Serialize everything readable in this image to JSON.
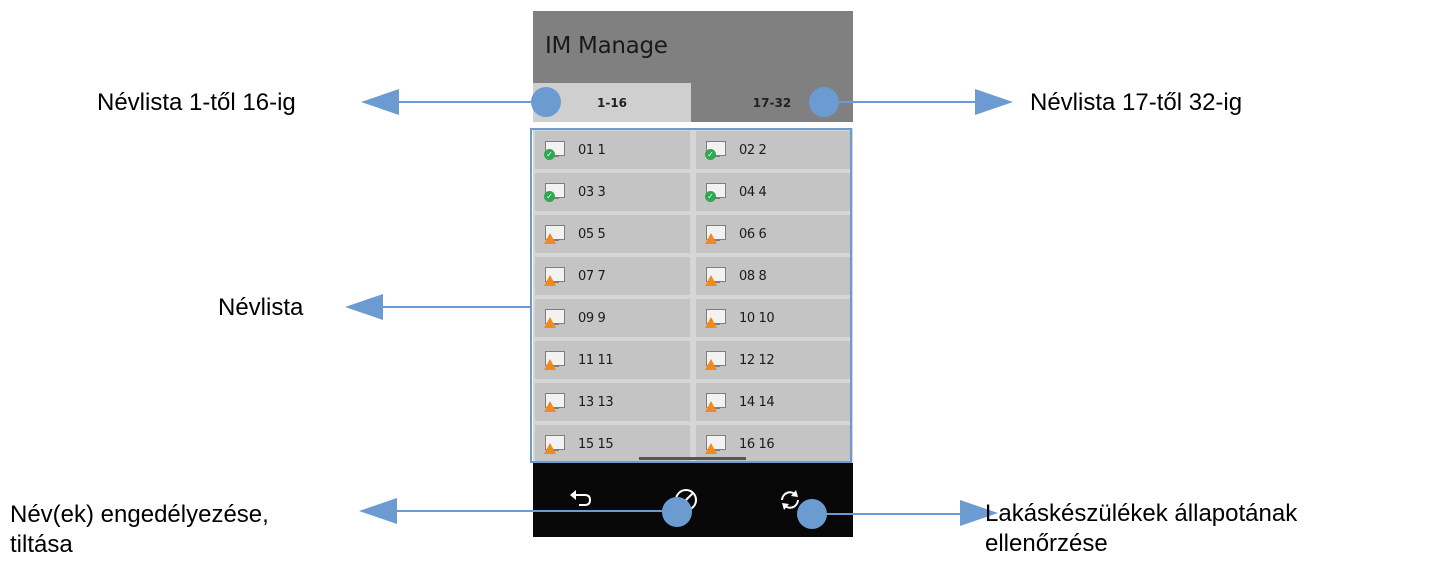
{
  "app": {
    "title": "IM Manage"
  },
  "tabs": [
    {
      "label": "1-16",
      "active": true
    },
    {
      "label": "17-32",
      "active": false
    }
  ],
  "list": {
    "items": [
      {
        "label": "01 1",
        "status": "ok"
      },
      {
        "label": "02 2",
        "status": "ok"
      },
      {
        "label": "03 3",
        "status": "ok"
      },
      {
        "label": "04 4",
        "status": "ok"
      },
      {
        "label": "05 5",
        "status": "warning"
      },
      {
        "label": "06 6",
        "status": "warning"
      },
      {
        "label": "07 7",
        "status": "warning"
      },
      {
        "label": "08 8",
        "status": "warning"
      },
      {
        "label": "09 9",
        "status": "warning"
      },
      {
        "label": "10 10",
        "status": "warning"
      },
      {
        "label": "11 11",
        "status": "warning"
      },
      {
        "label": "12 12",
        "status": "warning"
      },
      {
        "label": "13 13",
        "status": "warning"
      },
      {
        "label": "14 14",
        "status": "warning"
      },
      {
        "label": "15 15",
        "status": "warning"
      },
      {
        "label": "16 16",
        "status": "warning"
      }
    ]
  },
  "bottom_bar": {
    "buttons": [
      {
        "icon": "back-arrow-icon"
      },
      {
        "icon": "disable-icon"
      },
      {
        "icon": "refresh-icon"
      }
    ]
  },
  "annotations": {
    "range_1_16": "Névlista 1-től 16-ig",
    "range_17_32": "Névlista 17-től 32-ig",
    "name_list": "Névlista",
    "enable_disable_line1": "Név(ek) engedélyezése,",
    "enable_disable_line2": "tiltása",
    "status_check_line1": "Lakáskészülékek állapotának",
    "status_check_line2": "ellenőrzése"
  },
  "colors": {
    "header_bg": "#808080",
    "active_tab_bg": "#cfcfcf",
    "cell_bg": "#c4c4c4",
    "bottom_bar_bg": "#080808",
    "annotation_accent": "#6b9bd1",
    "status_ok": "#2fa84f",
    "status_warning": "#f08a1c"
  }
}
